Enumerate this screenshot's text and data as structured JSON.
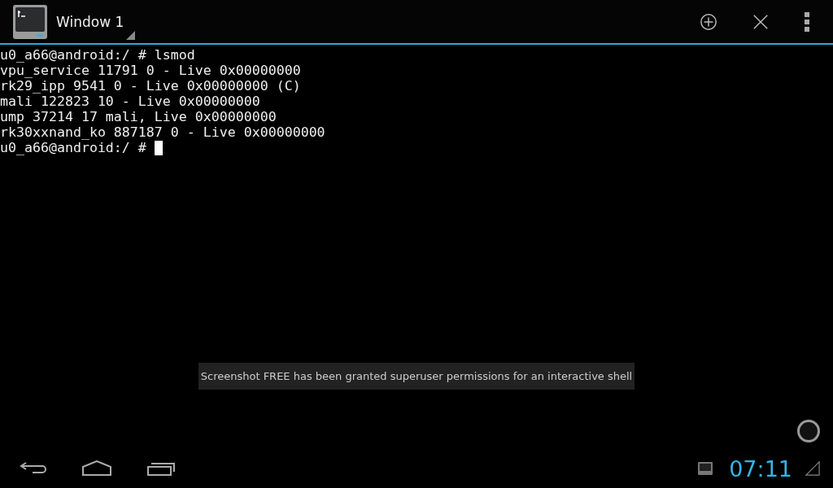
{
  "action_bar": {
    "title": "Window 1"
  },
  "terminal": {
    "lines": [
      "u0_a66@android:/ # lsmod",
      "vpu_service 11791 0 - Live 0x00000000",
      "rk29_ipp 9541 0 - Live 0x00000000 (C)",
      "mali 122823 10 - Live 0x00000000",
      "ump 37214 17 mali, Live 0x00000000",
      "rk30xxnand_ko 887187 0 - Live 0x00000000"
    ],
    "prompt": "u0_a66@android:/ #"
  },
  "toast": "Screenshot FREE has been granted superuser permissions for an interactive shell",
  "status_bar": {
    "time": "07:11"
  }
}
